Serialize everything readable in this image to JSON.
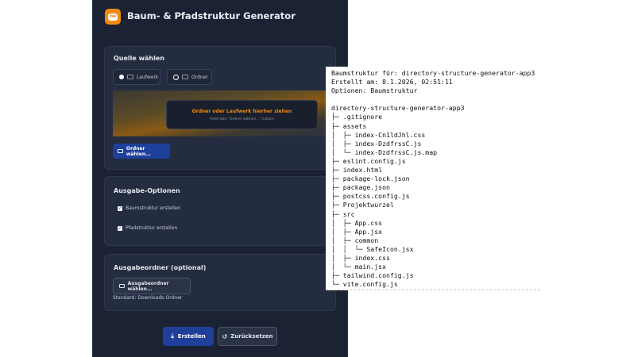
{
  "app": {
    "title": "Baum- & Pfadstruktur Generator",
    "logo_text": "ne"
  },
  "source": {
    "section_title": "Quelle wählen",
    "options": [
      {
        "label": "Laufwerk",
        "selected": true
      },
      {
        "label": "Ordner",
        "selected": false
      }
    ],
    "drop_main": "Ordner oder Laufwerk hierher ziehen",
    "drop_sub": "Alternativ 'Ordner wählen...' nutzen",
    "choose_button": "Ordner wählen..."
  },
  "output_options": {
    "section_title": "Ausgabe-Optionen",
    "checkboxes": [
      {
        "label": "Baumstruktur erstellen",
        "checked": true
      },
      {
        "label": "Pfadstruktur erstellen",
        "checked": true
      }
    ]
  },
  "output_folder": {
    "section_title": "Ausgabeordner (optional)",
    "choose_button": "Ausgabeordner wählen...",
    "default_text": "Standard: Downloads-Ordner"
  },
  "actions": {
    "create": "Erstellen",
    "reset": "Zurücksetzen"
  },
  "colors": {
    "panel_bg": "#1b2234",
    "card_bg": "#242c40",
    "accent_orange": "#f08a12",
    "primary_blue": "#1e3f9a"
  },
  "tree_output": {
    "lines": [
      "Baumstruktur für: directory-structure-generator-app3",
      "Erstellt am: 8.1.2026, 02:51:11",
      "Optionen: Baumstruktur",
      "",
      "directory-structure-generator-app3",
      "├─ .gitignore",
      "├─ assets",
      "│  ├─ index-Cn1ldJhl.css",
      "│  ├─ index-DzdfrssC.js",
      "│  └─ index-DzdfrssC.js.map",
      "├─ eslint.config.js",
      "├─ index.html",
      "├─ package-lock.json",
      "├─ package.json",
      "├─ postcss.config.js",
      "├─ Projektwurzel",
      "├─ src",
      "│  ├─ App.css",
      "│  ├─ App.jsx",
      "│  ├─ common",
      "│  │  └─ SafeIcon.jsx",
      "│  ├─ index.css",
      "│  └─ main.jsx",
      "├─ tailwind.config.js",
      "└─ vite.config.js"
    ]
  }
}
